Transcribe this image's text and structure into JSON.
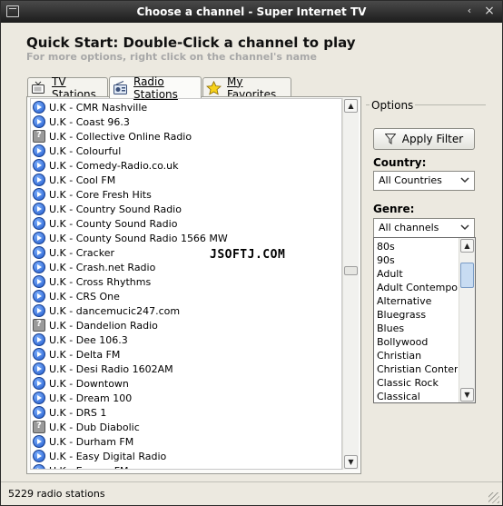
{
  "window": {
    "title": "Choose a channel - Super Internet TV",
    "minimize_glyph": "‹",
    "close_glyph": "×"
  },
  "header": {
    "title": "Quick Start: Double-Click a channel to play",
    "subtitle": "For more options, right click on the channel's name"
  },
  "tabs": [
    {
      "label": "TV Stations",
      "icon": "tv-icon",
      "active": false
    },
    {
      "label": "Radio Stations",
      "icon": "radio-icon",
      "active": true
    },
    {
      "label": "My Favorites",
      "icon": "star-icon",
      "active": false
    }
  ],
  "stations": [
    {
      "name": "U.K - CMR Nashville",
      "icon": "play"
    },
    {
      "name": "U.K - Coast 96.3",
      "icon": "play"
    },
    {
      "name": "U.K - Collective Online Radio",
      "icon": "unknown"
    },
    {
      "name": "U.K - Colourful",
      "icon": "play"
    },
    {
      "name": "U.K - Comedy-Radio.co.uk",
      "icon": "play"
    },
    {
      "name": "U.K - Cool FM",
      "icon": "play"
    },
    {
      "name": "U.K - Core Fresh Hits",
      "icon": "play"
    },
    {
      "name": "U.K - Country Sound Radio",
      "icon": "play"
    },
    {
      "name": "U.K - County Sound Radio",
      "icon": "play"
    },
    {
      "name": "U.K - County Sound Radio 1566 MW",
      "icon": "play"
    },
    {
      "name": "U.K - Cracker",
      "icon": "play"
    },
    {
      "name": "U.K - Crash.net Radio",
      "icon": "play"
    },
    {
      "name": "U.K - Cross Rhythms",
      "icon": "play"
    },
    {
      "name": "U.K - CRS One",
      "icon": "play"
    },
    {
      "name": "U.K - dancemucic247.com",
      "icon": "play"
    },
    {
      "name": "U.K - Dandelion Radio",
      "icon": "unknown"
    },
    {
      "name": "U.K - Dee 106.3",
      "icon": "play"
    },
    {
      "name": "U.K - Delta FM",
      "icon": "play"
    },
    {
      "name": "U.K - Desi Radio 1602AM",
      "icon": "play"
    },
    {
      "name": "U.K - Downtown",
      "icon": "play"
    },
    {
      "name": "U.K - Dream 100",
      "icon": "play"
    },
    {
      "name": "U.K - DRS 1",
      "icon": "play"
    },
    {
      "name": "U.K - Dub Diabolic",
      "icon": "unknown"
    },
    {
      "name": "U.K - Durham FM",
      "icon": "play"
    },
    {
      "name": "U.K - Easy Digital Radio",
      "icon": "play"
    },
    {
      "name": "U.K - Energy FM",
      "icon": "play"
    }
  ],
  "list_scroll_position": 0.46,
  "watermark": "JSOFTJ.COM",
  "options": {
    "group_label": "Options",
    "apply_filter_label": "Apply Filter",
    "country_label": "Country:",
    "country_value": "All Countries",
    "genre_label": "Genre:",
    "genre_value": "All channels",
    "genre_options": [
      "80s",
      "90s",
      "Adult",
      "Adult Contemporary",
      "Alternative",
      "Bluegrass",
      "Blues",
      "Bollywood",
      "Christian",
      "Christian Contemporary",
      "Classic Rock",
      "Classical"
    ]
  },
  "status": {
    "text": "5229 radio stations"
  },
  "colors": {
    "titlebar": "#2b2b2b",
    "window_bg": "#ece9e0",
    "play_icon": "#1d56c8"
  }
}
